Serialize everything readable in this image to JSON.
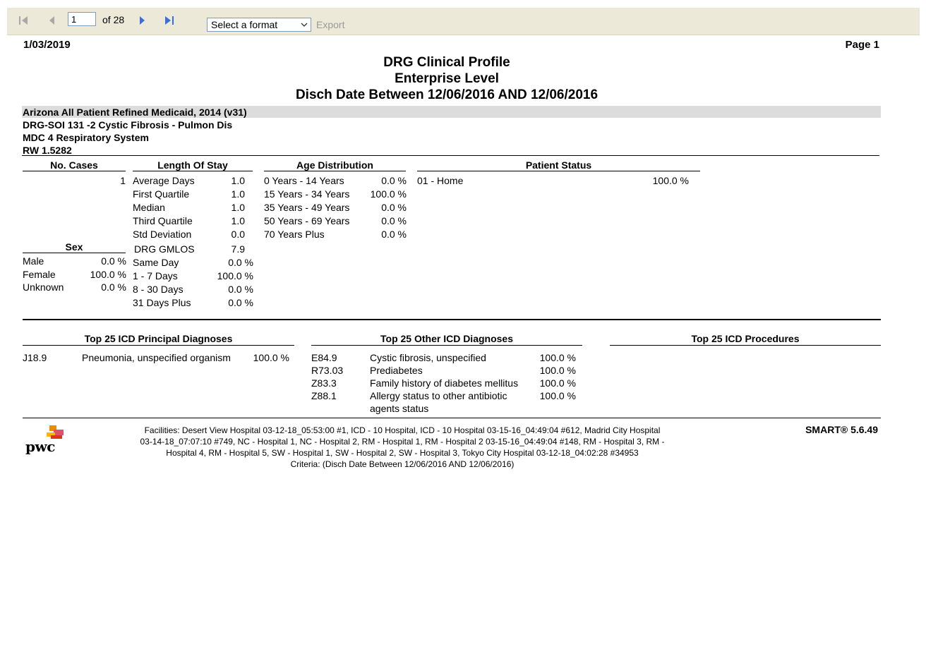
{
  "toolbar": {
    "page_value": "1",
    "page_of": "of 28",
    "format_placeholder": "Select a format",
    "export_label": "Export"
  },
  "report": {
    "date": "1/03/2019",
    "page_label": "Page 1",
    "title1": "DRG Clinical Profile",
    "title2": "Enterprise Level",
    "title3": "Disch Date Between 12/06/2016 AND 12/06/2016",
    "grouper": "Arizona All Patient Refined Medicaid, 2014 (v31)",
    "drg": "DRG-SOI 131 -2 Cystic Fibrosis - Pulmon Dis",
    "mdc": "MDC 4 Respiratory System",
    "rw": "RW  1.5282"
  },
  "cases": {
    "header": "No. Cases",
    "value": "1"
  },
  "sex": {
    "header": "Sex",
    "rows": [
      {
        "label": "Male",
        "value": "0.0 %"
      },
      {
        "label": "Female",
        "value": "100.0 %"
      },
      {
        "label": "Unknown",
        "value": "0.0 %"
      }
    ]
  },
  "los": {
    "header": "Length Of Stay",
    "rows": [
      {
        "label": "Average Days",
        "value": "1.0"
      },
      {
        "label": "First Quartile",
        "value": "1.0"
      },
      {
        "label": "Median",
        "value": "1.0"
      },
      {
        "label": "Third Quartile",
        "value": "1.0"
      },
      {
        "label": "Std Deviation",
        "value": "0.0"
      },
      {
        "label": "DRG GMLOS",
        "value": "7.9"
      },
      {
        "label": "Same Day",
        "value": "0.0 %"
      },
      {
        "label": "1 - 7 Days",
        "value": "100.0 %"
      },
      {
        "label": "8 - 30 Days",
        "value": "0.0 %"
      },
      {
        "label": "31 Days Plus",
        "value": "0.0 %"
      }
    ]
  },
  "age": {
    "header": "Age Distribution",
    "rows": [
      {
        "label": "0 Years - 14 Years",
        "value": "0.0 %"
      },
      {
        "label": "15 Years - 34 Years",
        "value": "100.0 %"
      },
      {
        "label": "35 Years - 49 Years",
        "value": "0.0 %"
      },
      {
        "label": "50 Years - 69 Years",
        "value": "0.0 %"
      },
      {
        "label": "70 Years Plus",
        "value": "0.0 %"
      }
    ]
  },
  "status": {
    "header": "Patient Status",
    "rows": [
      {
        "label": "01 - Home",
        "value": "100.0 %"
      }
    ]
  },
  "principal": {
    "header": "Top 25 ICD Principal Diagnoses",
    "rows": [
      {
        "code": "J18.9",
        "desc": "Pneumonia, unspecified organism",
        "value": "100.0 %"
      }
    ]
  },
  "other": {
    "header": "Top 25 Other ICD Diagnoses",
    "rows": [
      {
        "code": "E84.9",
        "desc": "Cystic fibrosis, unspecified",
        "desc2": "",
        "value": "100.0 %"
      },
      {
        "code": "R73.03",
        "desc": "Prediabetes",
        "desc2": "",
        "value": "100.0 %"
      },
      {
        "code": "Z83.3",
        "desc": "Family history of diabetes mellitus",
        "desc2": "",
        "value": "100.0 %"
      },
      {
        "code": "Z88.1",
        "desc": "Allergy status to other antibiotic",
        "desc2": "agents status",
        "value": "100.0 %"
      }
    ]
  },
  "procedures": {
    "header": "Top 25 ICD Procedures"
  },
  "footer": {
    "logo_text": "pwc",
    "facilities_line1": "Facilities: Desert View Hospital 03-12-18_05:53:00 #1, ICD - 10 Hospital, ICD - 10 Hospital 03-15-16_04:49:04 #612, Madrid City Hospital",
    "facilities_line2": "03-14-18_07:07:10 #749, NC - Hospital 1, NC - Hospital 2, RM - Hospital 1, RM - Hospital 2 03-15-16_04:49:04 #148, RM - Hospital 3, RM -",
    "facilities_line3": "Hospital 4, RM - Hospital 5, SW - Hospital 1, SW - Hospital 2, SW - Hospital 3, Tokyo City Hospital 03-12-18_04:02:28 #34953",
    "criteria": "Criteria: (Disch Date Between 12/06/2016 AND 12/06/2016)",
    "version": "SMART® 5.6.49"
  },
  "colors": {
    "toolbar_bg": "#ece9d8",
    "band_bg": "#dcdcdc",
    "logo_orange": "#e0301e"
  }
}
